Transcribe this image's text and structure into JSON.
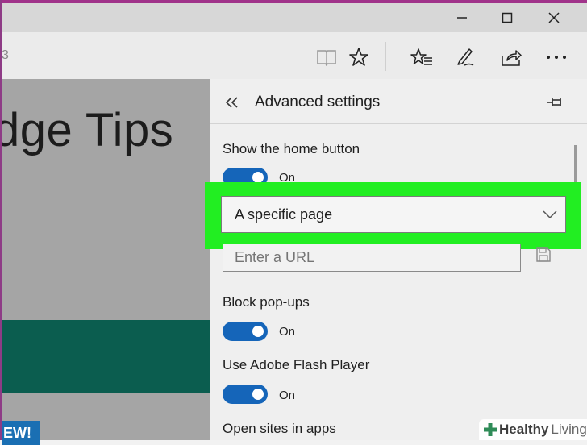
{
  "window": {
    "minimize_icon": "minimize-icon",
    "maximize_icon": "maximize-icon",
    "close_icon": "close-icon"
  },
  "toolbar": {
    "address_fragment": "3",
    "icons": [
      "reading-view-icon",
      "favorite-star-icon",
      "hub-icon",
      "web-note-icon",
      "share-icon",
      "more-icon"
    ]
  },
  "page": {
    "title_fragment": "dge Tips",
    "badge_text": "EW!"
  },
  "settings": {
    "title": "Advanced settings",
    "home_button": {
      "label": "Show the home button",
      "state": "On",
      "dropdown_value": "A specific page",
      "url_placeholder": "Enter a URL"
    },
    "popups": {
      "label": "Block pop-ups",
      "state": "On"
    },
    "flash": {
      "label": "Use Adobe Flash Player",
      "state": "On"
    },
    "apps": {
      "label": "Open sites in apps"
    }
  },
  "colors": {
    "accent": "#1565b9",
    "highlight": "#22ee22",
    "banner": "#0b5d4f"
  },
  "watermark": {
    "part1": "Healthy",
    "part2": "Living"
  }
}
